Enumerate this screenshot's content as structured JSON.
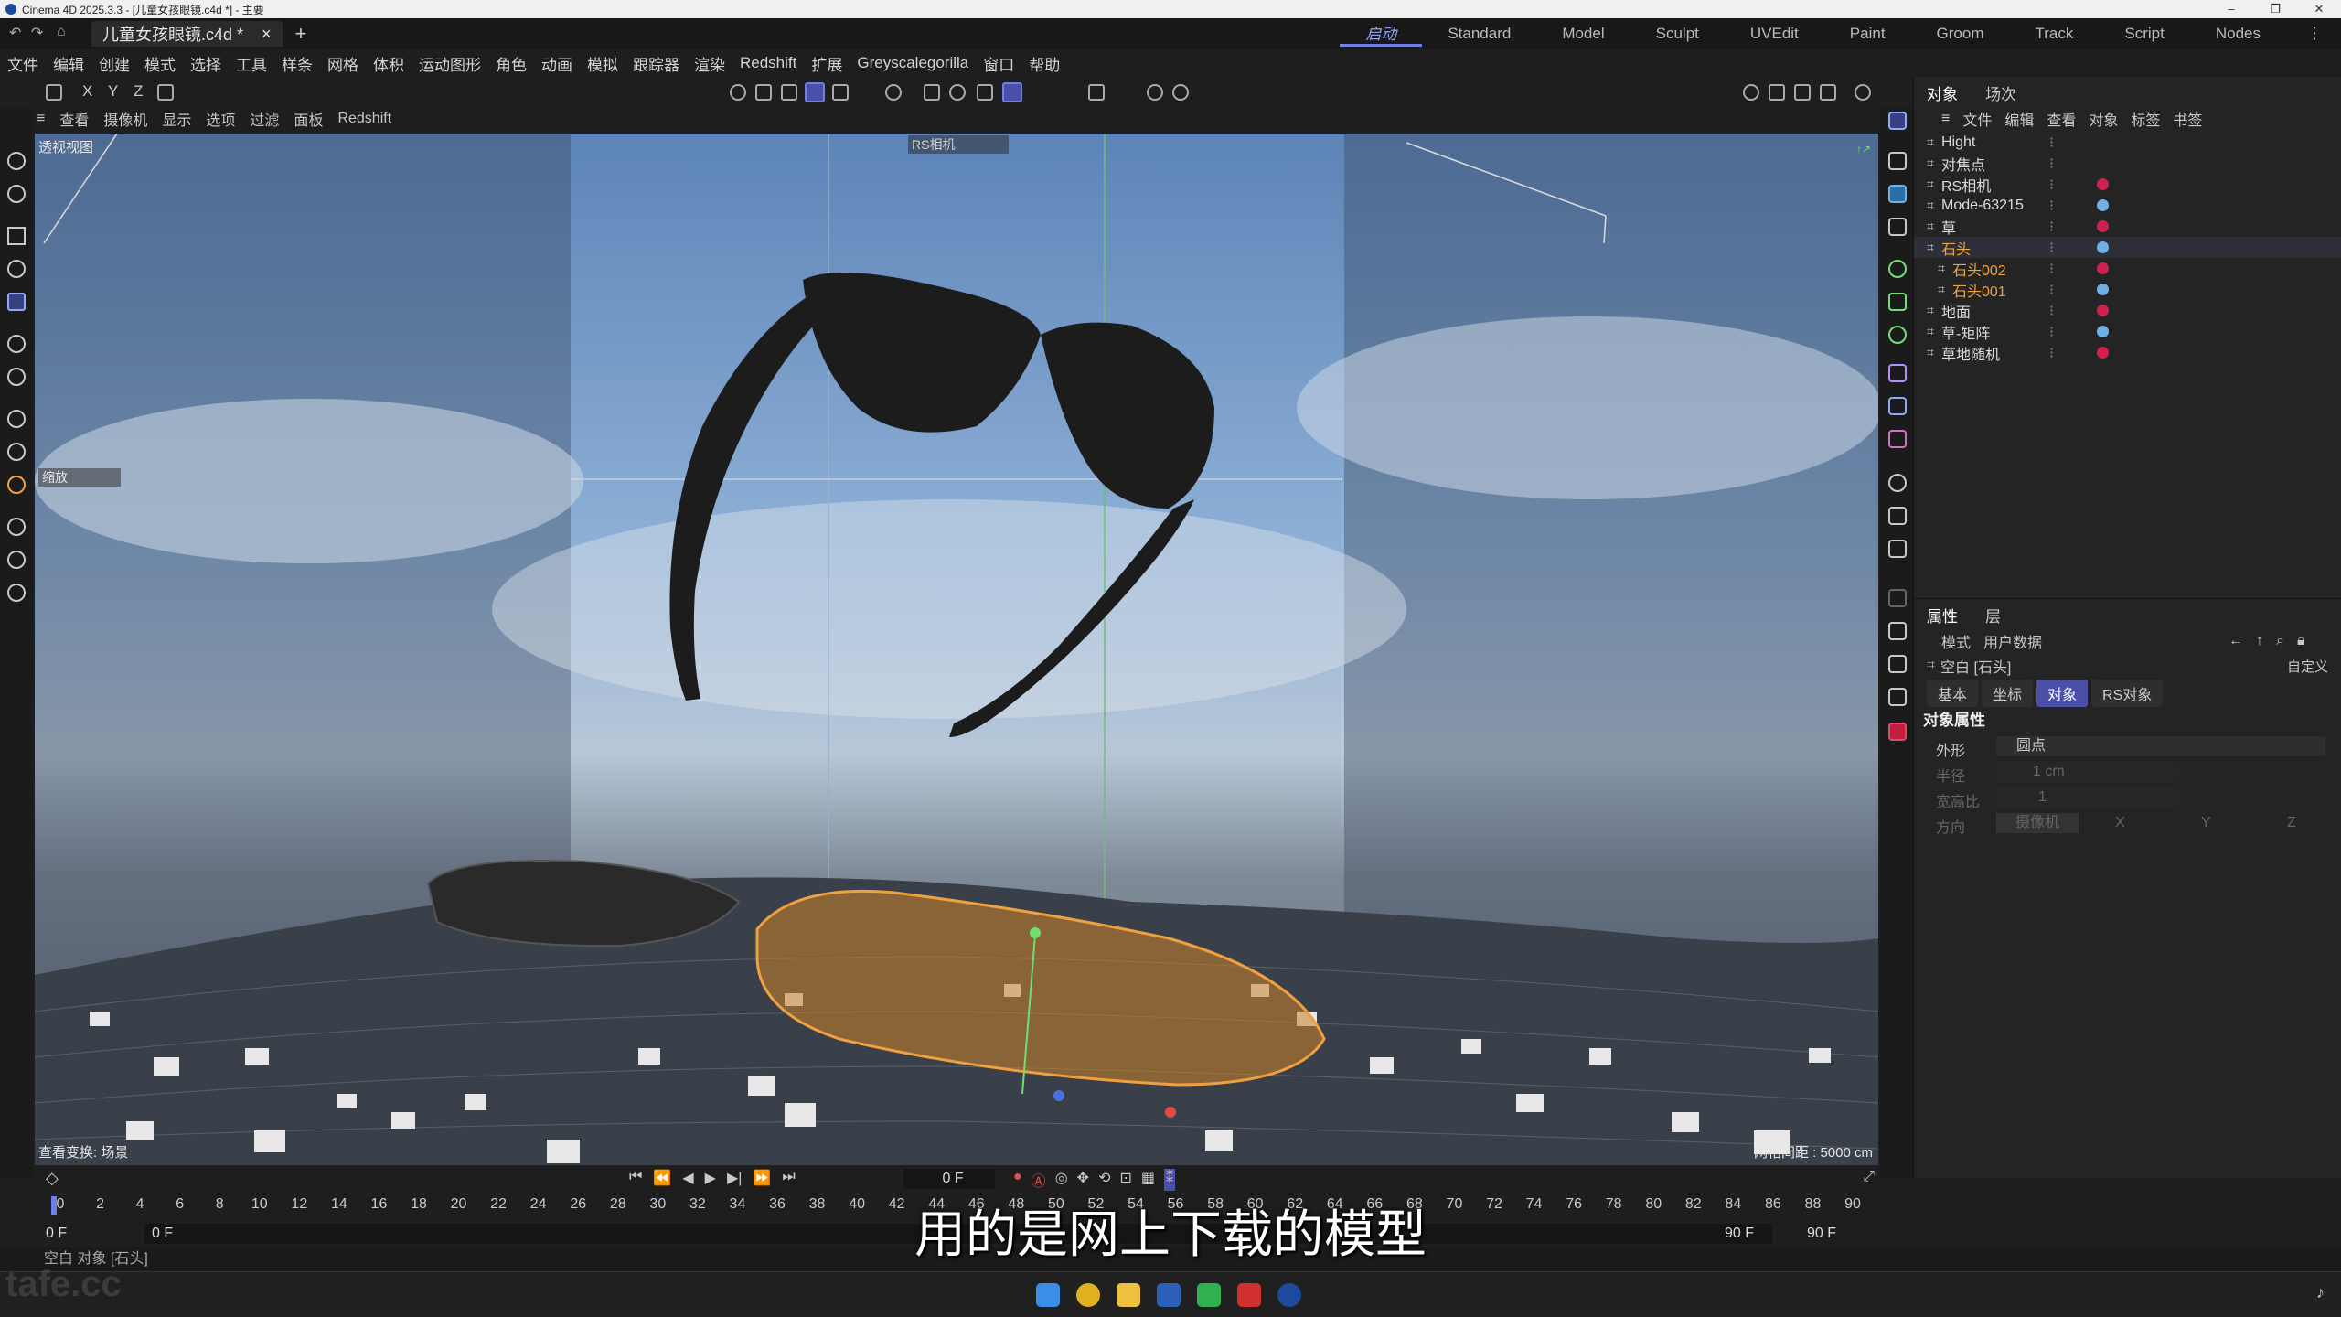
{
  "window": {
    "title": "Cinema 4D 2025.3.3 - [儿童女孩眼镜.c4d *] - 主要"
  },
  "doc_tab": {
    "label": "儿童女孩眼镜.c4d *",
    "close": "×",
    "add": "+"
  },
  "layouts": [
    "启动",
    "Standard",
    "Model",
    "Sculpt",
    "UVEdit",
    "Paint",
    "Groom",
    "Track",
    "Script",
    "Nodes"
  ],
  "menu": [
    "文件",
    "编辑",
    "创建",
    "模式",
    "选择",
    "工具",
    "样条",
    "网格",
    "体积",
    "运动图形",
    "角色",
    "动画",
    "模拟",
    "跟踪器",
    "渲染",
    "Redshift",
    "扩展",
    "Greyscalegorilla",
    "窗口",
    "帮助"
  ],
  "axes": {
    "x": "X",
    "y": "Y",
    "z": "Z"
  },
  "view_menu": [
    "查看",
    "摄像机",
    "显示",
    "选项",
    "过滤",
    "面板",
    "Redshift"
  ],
  "viewport": {
    "name": "透视视图",
    "camera": "RS相机",
    "zoom_label": "缩放",
    "transform_status": "查看变换: 场景",
    "grid_spacing": "网格间距 : 5000 cm"
  },
  "object_panel": {
    "tabs": [
      "对象",
      "场次"
    ],
    "menu": [
      "文件",
      "编辑",
      "查看",
      "对象",
      "标签",
      "书签"
    ],
    "objects": [
      {
        "name": "Hight",
        "indent": 0,
        "selected": false,
        "orange": false
      },
      {
        "name": "对焦点",
        "indent": 0,
        "selected": false,
        "orange": false
      },
      {
        "name": "RS相机",
        "indent": 0,
        "selected": false,
        "orange": false
      },
      {
        "name": "Mode-63215",
        "indent": 0,
        "selected": false,
        "orange": false
      },
      {
        "name": "草",
        "indent": 0,
        "selected": false,
        "orange": false
      },
      {
        "name": "石头",
        "indent": 0,
        "selected": true,
        "orange": true
      },
      {
        "name": "石头002",
        "indent": 1,
        "selected": false,
        "orange": true
      },
      {
        "name": "石头001",
        "indent": 1,
        "selected": false,
        "orange": true
      },
      {
        "name": "地面",
        "indent": 0,
        "selected": false,
        "orange": false
      },
      {
        "name": "草-矩阵",
        "indent": 0,
        "selected": false,
        "orange": false
      },
      {
        "name": "草地随机",
        "indent": 0,
        "selected": false,
        "orange": false
      }
    ]
  },
  "attributes": {
    "tabs": [
      "属性",
      "层"
    ],
    "menu": [
      "模式",
      "用户数据"
    ],
    "object_title": "空白 [石头]",
    "preset": "自定义",
    "sub_tabs": [
      "基本",
      "坐标",
      "对象",
      "RS对象"
    ],
    "active_sub_tab": "对象",
    "section": "对象属性",
    "display_label": "外形",
    "display_value": "圆点",
    "radius_label": "半径",
    "radius_value": "1 cm",
    "aspect_label": "宽高比",
    "aspect_value": "1",
    "orientation_label": "方向",
    "orientation_value": "摄像机",
    "orient_axes": [
      "X",
      "Y",
      "Z"
    ]
  },
  "timeline": {
    "current_frame": "0 F",
    "start_frame": "0 F",
    "min_frame": "0 F",
    "max_frame": "90 F",
    "end_frame": "90 F",
    "ticks": [
      "0",
      "2",
      "4",
      "6",
      "8",
      "10",
      "12",
      "14",
      "16",
      "18",
      "20",
      "22",
      "24",
      "26",
      "28",
      "30",
      "32",
      "34",
      "36",
      "38",
      "40",
      "42",
      "44",
      "46",
      "48",
      "50",
      "52",
      "54",
      "56",
      "58",
      "60",
      "62",
      "64",
      "66",
      "68",
      "70",
      "72",
      "74",
      "76",
      "78",
      "80",
      "82",
      "84",
      "86",
      "88",
      "90"
    ]
  },
  "status_bar": {
    "text": "空白 对象 [石头]"
  },
  "subtitle": "用的是网上下载的模型",
  "watermark": "tafe.cc",
  "colors": {
    "accent": "#6f7fe6",
    "selection": "#f0a040",
    "bg": "#1e1e1e"
  }
}
